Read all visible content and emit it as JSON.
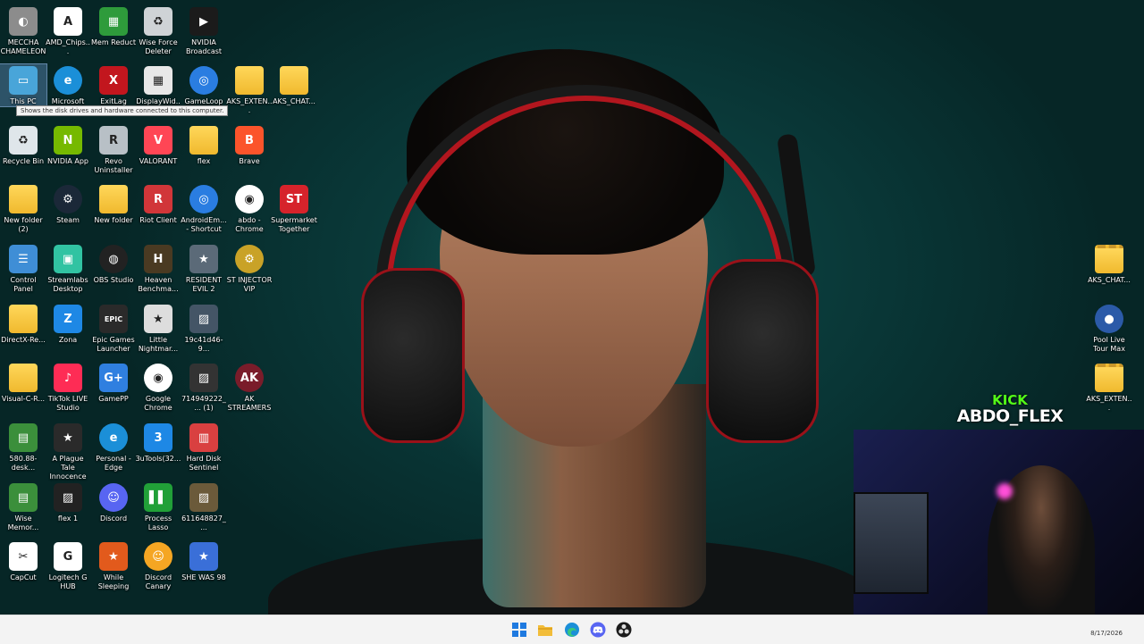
{
  "desktop": {
    "icons": [
      {
        "label": "MECCHA CHAMELEON",
        "icon": "chameleon-app-icon",
        "color": "#8c8c8c"
      },
      {
        "label": "AMD_Chips...",
        "icon": "amd-icon",
        "color": "#ffffff"
      },
      {
        "label": "Mem Reduct",
        "icon": "memory-chip-icon",
        "color": "#2e9b3b"
      },
      {
        "label": "Wise Force Deleter",
        "icon": "recycle-bin-icon",
        "color": "#cfd3d6"
      },
      {
        "label": "NVIDIA Broadcast",
        "icon": "nvidia-broadcast-icon",
        "color": "#1b1b1b"
      },
      {
        "label": "This PC",
        "icon": "computer-icon",
        "color": "#49a5d9"
      },
      {
        "label": "Microsoft",
        "icon": "edge-icon",
        "color": "#1b8fd8"
      },
      {
        "label": "ExitLag",
        "icon": "exitlag-icon",
        "color": "#c2161e"
      },
      {
        "label": "DisplayWid...",
        "icon": "display-icon",
        "color": "#e8e8e8"
      },
      {
        "label": "GameLoop",
        "icon": "gameloop-icon",
        "color": "#2a7de1"
      },
      {
        "label": "AKS_EXTEN...",
        "icon": "folder-icon",
        "color": "#f5c542"
      },
      {
        "label": "AKS_CHAT...",
        "icon": "folder-icon",
        "color": "#f5c542"
      },
      {
        "label": "Recycle Bin",
        "icon": "recycle-bin-icon",
        "color": "#dfe6ea"
      },
      {
        "label": "NVIDIA App",
        "icon": "nvidia-icon",
        "color": "#76b900"
      },
      {
        "label": "Revo Uninstaller",
        "icon": "revo-icon",
        "color": "#b8c0c6"
      },
      {
        "label": "VALORANT",
        "icon": "valorant-icon",
        "color": "#ff4655"
      },
      {
        "label": "flex",
        "icon": "folder-icon",
        "color": "#f5c542"
      },
      {
        "label": "Brave",
        "icon": "brave-icon",
        "color": "#fb542b"
      },
      {
        "label": "New folder (2)",
        "icon": "folder-icon",
        "color": "#f5c542"
      },
      {
        "label": "Steam",
        "icon": "steam-icon",
        "color": "#1b2838"
      },
      {
        "label": "New folder",
        "icon": "folder-icon",
        "color": "#f5c542"
      },
      {
        "label": "Riot Client",
        "icon": "riot-icon",
        "color": "#d13639"
      },
      {
        "label": "AndroidEm... - Shortcut",
        "icon": "emulator-icon",
        "color": "#2a7de1"
      },
      {
        "label": "abdo - Chrome",
        "icon": "chrome-icon",
        "color": "#ffffff"
      },
      {
        "label": "Supermarket Together",
        "icon": "supermarket-icon",
        "color": "#d6232b"
      },
      {
        "label": "Control Panel",
        "icon": "control-panel-icon",
        "color": "#3f8ed6"
      },
      {
        "label": "Streamlabs Desktop",
        "icon": "streamlabs-icon",
        "color": "#31c3a2"
      },
      {
        "label": "OBS Studio",
        "icon": "obs-icon",
        "color": "#222222"
      },
      {
        "label": "Heaven Benchma...",
        "icon": "heaven-icon",
        "color": "#4a3a22"
      },
      {
        "label": "RESIDENT EVIL 2",
        "icon": "game-icon",
        "color": "#5b6a78"
      },
      {
        "label": "ST INJECTOR VIP",
        "icon": "steam-gear-icon",
        "color": "#c9a227"
      },
      {
        "label": "DirectX-Re...",
        "icon": "folder-icon",
        "color": "#f5c542"
      },
      {
        "label": "Zona",
        "icon": "zona-icon",
        "color": "#1e88e5"
      },
      {
        "label": "Epic Games Launcher",
        "icon": "epic-icon",
        "color": "#2a2a2a"
      },
      {
        "label": "Little Nightmar...",
        "icon": "game-icon",
        "color": "#dddddd"
      },
      {
        "label": "19c41d46-9...",
        "icon": "image-file-icon",
        "color": "#445566"
      },
      {
        "label": "Visual-C-R...",
        "icon": "folder-icon",
        "color": "#f5c542"
      },
      {
        "label": "TikTok LIVE Studio",
        "icon": "tiktok-icon",
        "color": "#fe2c55"
      },
      {
        "label": "GamePP",
        "icon": "gamepp-icon",
        "color": "#2f7fe0"
      },
      {
        "label": "Google Chrome",
        "icon": "chrome-icon",
        "color": "#ffffff"
      },
      {
        "label": "714949222_... (1)",
        "icon": "image-file-icon",
        "color": "#333333"
      },
      {
        "label": "AK STREAMERS",
        "icon": "ak-logo-icon",
        "color": "#7a1c2a"
      },
      {
        "label": "580.88-desk...",
        "icon": "nvidia-installer-icon",
        "color": "#3b8f3b"
      },
      {
        "label": "A Plague Tale Innocence",
        "icon": "game-icon",
        "color": "#2a2a2a"
      },
      {
        "label": "Personal - Edge",
        "icon": "edge-icon",
        "color": "#1b8fd8"
      },
      {
        "label": "3uTools(32...",
        "icon": "3utools-icon",
        "color": "#1e88e5"
      },
      {
        "label": "Hard Disk Sentinel",
        "icon": "disk-icon",
        "color": "#d94040"
      },
      {
        "label": "Wise Memor...",
        "icon": "wise-memory-icon",
        "color": "#3b8f3b"
      },
      {
        "label": "flex 1",
        "icon": "image-file-icon",
        "color": "#222222"
      },
      {
        "label": "Discord",
        "icon": "discord-icon",
        "color": "#5865f2"
      },
      {
        "label": "Process Lasso",
        "icon": "process-lasso-icon",
        "color": "#21a038"
      },
      {
        "label": "611648827_...",
        "icon": "image-file-icon",
        "color": "#6b5a3a"
      },
      {
        "label": "CapCut",
        "icon": "capcut-icon",
        "color": "#ffffff"
      },
      {
        "label": "Logitech G HUB",
        "icon": "logitech-icon",
        "color": "#ffffff"
      },
      {
        "label": "While Sleeping",
        "icon": "game-icon",
        "color": "#e25a1c"
      },
      {
        "label": "Discord Canary",
        "icon": "discord-icon",
        "color": "#f5a623"
      },
      {
        "label": "SHE WAS 98",
        "icon": "game-icon",
        "color": "#3a6fd8"
      },
      {
        "label": "AKS_CHAT...",
        "icon": "zip-folder-icon",
        "color": "#f5c542"
      },
      {
        "label": "Pool Live Tour Max",
        "icon": "pool-icon",
        "color": "#2b5aa8"
      },
      {
        "label": "AKS_EXTEN...",
        "icon": "zip-folder-icon",
        "color": "#f5c542"
      }
    ],
    "tooltip": "Shows the disk drives and hardware connected to this computer."
  },
  "overlay": {
    "kick_label": "KICK",
    "streamer_name": "ABDO_FLEX"
  },
  "taskbar": {
    "items": [
      "start-icon",
      "file-explorer-icon",
      "edge-icon",
      "discord-icon",
      "obs-icon"
    ],
    "date": "8/17/2026"
  }
}
